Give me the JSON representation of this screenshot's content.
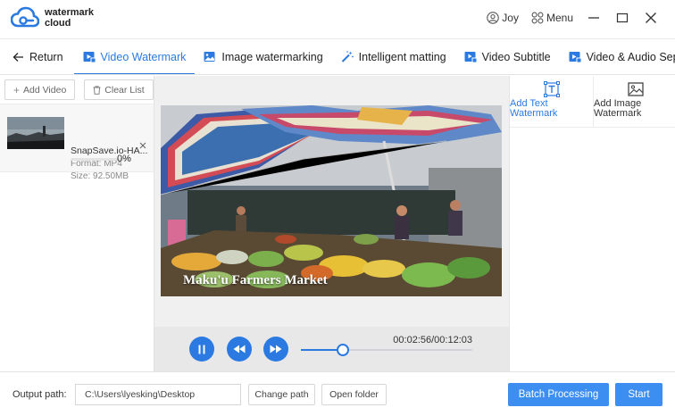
{
  "app": {
    "logo_line1": "watermark",
    "logo_line2": "cloud",
    "user_label": "Joy",
    "menu_label": "Menu",
    "accent_color": "#2a7ae2"
  },
  "tabs": [
    {
      "label": "Return",
      "icon": "arrow-left-icon"
    },
    {
      "label": "Video Watermark",
      "icon": "video-icon",
      "active": true
    },
    {
      "label": "Image watermarking",
      "icon": "image-icon"
    },
    {
      "label": "Intelligent matting",
      "icon": "magic-wand-icon"
    },
    {
      "label": "Video Subtitle",
      "icon": "subtitle-icon"
    },
    {
      "label": "Video & Audio Sepa",
      "icon": "separate-icon"
    }
  ],
  "left_panel": {
    "add_video_label": "Add Video",
    "clear_list_label": "Clear List",
    "file": {
      "name": "SnapSave.io-HA...",
      "format": "Format:  MP4",
      "size": "Size:  92.50MB",
      "progress": 0,
      "progress_text": "0%"
    }
  },
  "preview": {
    "caption": "Maku'u Farmers Market"
  },
  "player": {
    "time": "00:02:56/00:12:03",
    "position_fraction": 0.243
  },
  "right_panel": {
    "add_text_line1": "Add Text",
    "add_text_line2": "Watermark",
    "add_image_line1": "Add Image",
    "add_image_line2": "Watermark"
  },
  "bottom": {
    "output_label": "Output path:",
    "output_path": "C:\\Users\\lyesking\\Desktop",
    "change_path_label": "Change path",
    "open_folder_label": "Open folder",
    "batch_label": "Batch Processing",
    "start_label": "Start"
  }
}
